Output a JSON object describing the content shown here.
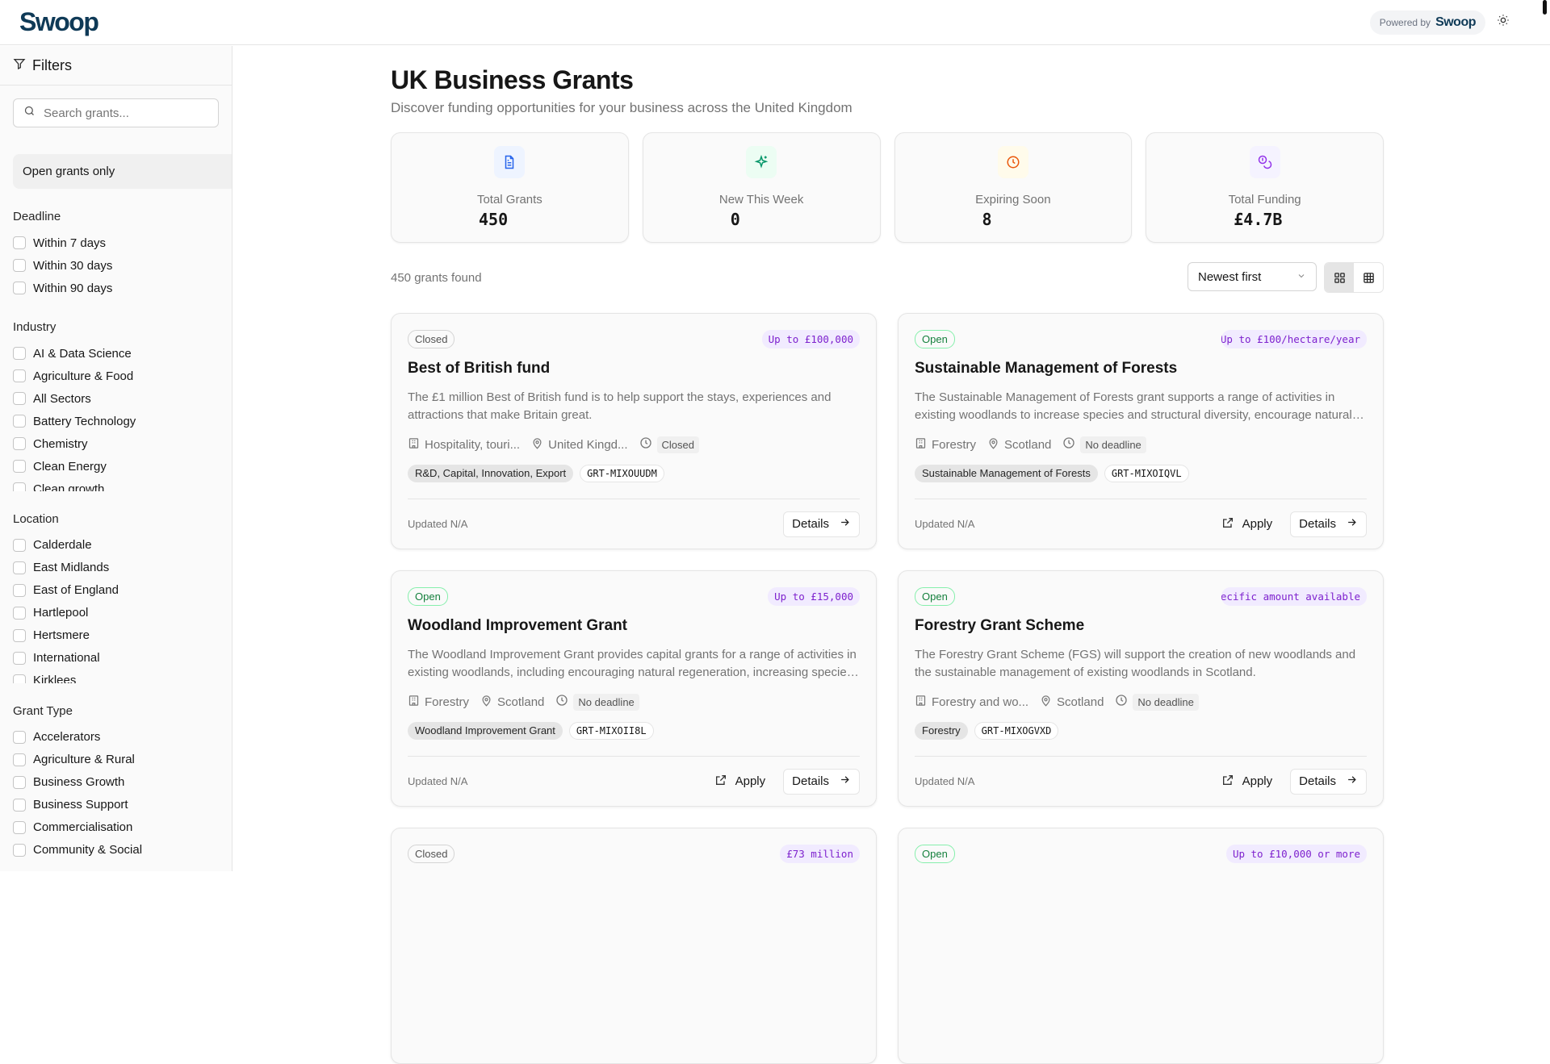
{
  "header": {
    "logo": "Swoop",
    "powered_by": "Powered by",
    "powered_brand": "Swoop"
  },
  "sidebar": {
    "title": "Filters",
    "search_placeholder": "Search grants...",
    "open_only": "Open grants only",
    "groups": [
      {
        "label": "Deadline",
        "items": [
          "Within 7 days",
          "Within 30 days",
          "Within 90 days"
        ]
      },
      {
        "label": "Industry",
        "items": [
          "AI & Data Science",
          "Agriculture & Food",
          "All Sectors",
          "Battery Technology",
          "Chemistry",
          "Clean Energy",
          "Clean growth"
        ]
      },
      {
        "label": "Location",
        "items": [
          "Calderdale",
          "East Midlands",
          "East of England",
          "Hartlepool",
          "Hertsmere",
          "International",
          "Kirklees"
        ]
      },
      {
        "label": "Grant Type",
        "items": [
          "Accelerators",
          "Agriculture & Rural",
          "Business Growth",
          "Business Support",
          "Commercialisation",
          "Community & Social"
        ]
      }
    ]
  },
  "main": {
    "title": "UK Business Grants",
    "subtitle": "Discover funding opportunities for your business across the United Kingdom",
    "stats": [
      {
        "label": "Total Grants",
        "value": "450",
        "icon": "document-icon",
        "color": "#2563eb",
        "bg": "#eef4ff"
      },
      {
        "label": "New This Week",
        "value": "0",
        "icon": "sparkle-icon",
        "color": "#059669",
        "bg": "#ecfdf3"
      },
      {
        "label": "Expiring Soon",
        "value": "8",
        "icon": "clock-icon",
        "color": "#ea580c",
        "bg": "#fffbeb"
      },
      {
        "label": "Total Funding",
        "value": "£4.7B",
        "icon": "coins-icon",
        "color": "#9333ea",
        "bg": "#f5f3ff"
      }
    ],
    "results_count": "450 grants found",
    "sort": "Newest first",
    "grants": [
      {
        "status": "Closed",
        "amount": "Up to £100,000",
        "title": "Best of British fund",
        "description": "The £1 million Best of British fund is to help support the stays, experiences and attractions that make Britain great.",
        "industry": "Hospitality, touri...",
        "location": "United Kingd...",
        "deadline": "Closed",
        "category": "R&D, Capital, Innovation, Export",
        "code": "GRT-MIXOUUDM",
        "updated": "Updated N/A",
        "apply": null,
        "details": "Details"
      },
      {
        "status": "Open",
        "amount": "Up to £100/hectare/year",
        "title": "Sustainable Management of Forests",
        "description": "The Sustainable Management of Forests grant supports a range of activities in existing woodlands to increase species and structural diversity, encourage natural regeneration.",
        "industry": "Forestry",
        "location": "Scotland",
        "deadline": "No deadline",
        "category": "Sustainable Management of Forests",
        "code": "GRT-MIXOIQVL",
        "updated": "Updated N/A",
        "apply": "Apply",
        "details": "Details"
      },
      {
        "status": "Open",
        "amount": "Up to £15,000",
        "title": "Woodland Improvement Grant",
        "description": "The Woodland Improvement Grant provides capital grants for a range of activities in existing woodlands, including encouraging natural regeneration, increasing species diversity.",
        "industry": "Forestry",
        "location": "Scotland",
        "deadline": "No deadline",
        "category": "Woodland Improvement Grant",
        "code": "GRT-MIXOII8L",
        "updated": "Updated N/A",
        "apply": "Apply",
        "details": "Details"
      },
      {
        "status": "Open",
        "amount": "No specific amount available",
        "title": "Forestry Grant Scheme",
        "description": "The Forestry Grant Scheme (FGS) will support the creation of new woodlands and the sustainable management of existing woodlands in Scotland.",
        "industry": "Forestry and wo...",
        "location": "Scotland",
        "deadline": "No deadline",
        "category": "Forestry",
        "code": "GRT-MIXOGVXD",
        "updated": "Updated N/A",
        "apply": "Apply",
        "details": "Details"
      },
      {
        "status": "Closed",
        "amount": "£73 million"
      },
      {
        "status": "Open",
        "amount": "Up to £10,000 or more"
      }
    ]
  }
}
